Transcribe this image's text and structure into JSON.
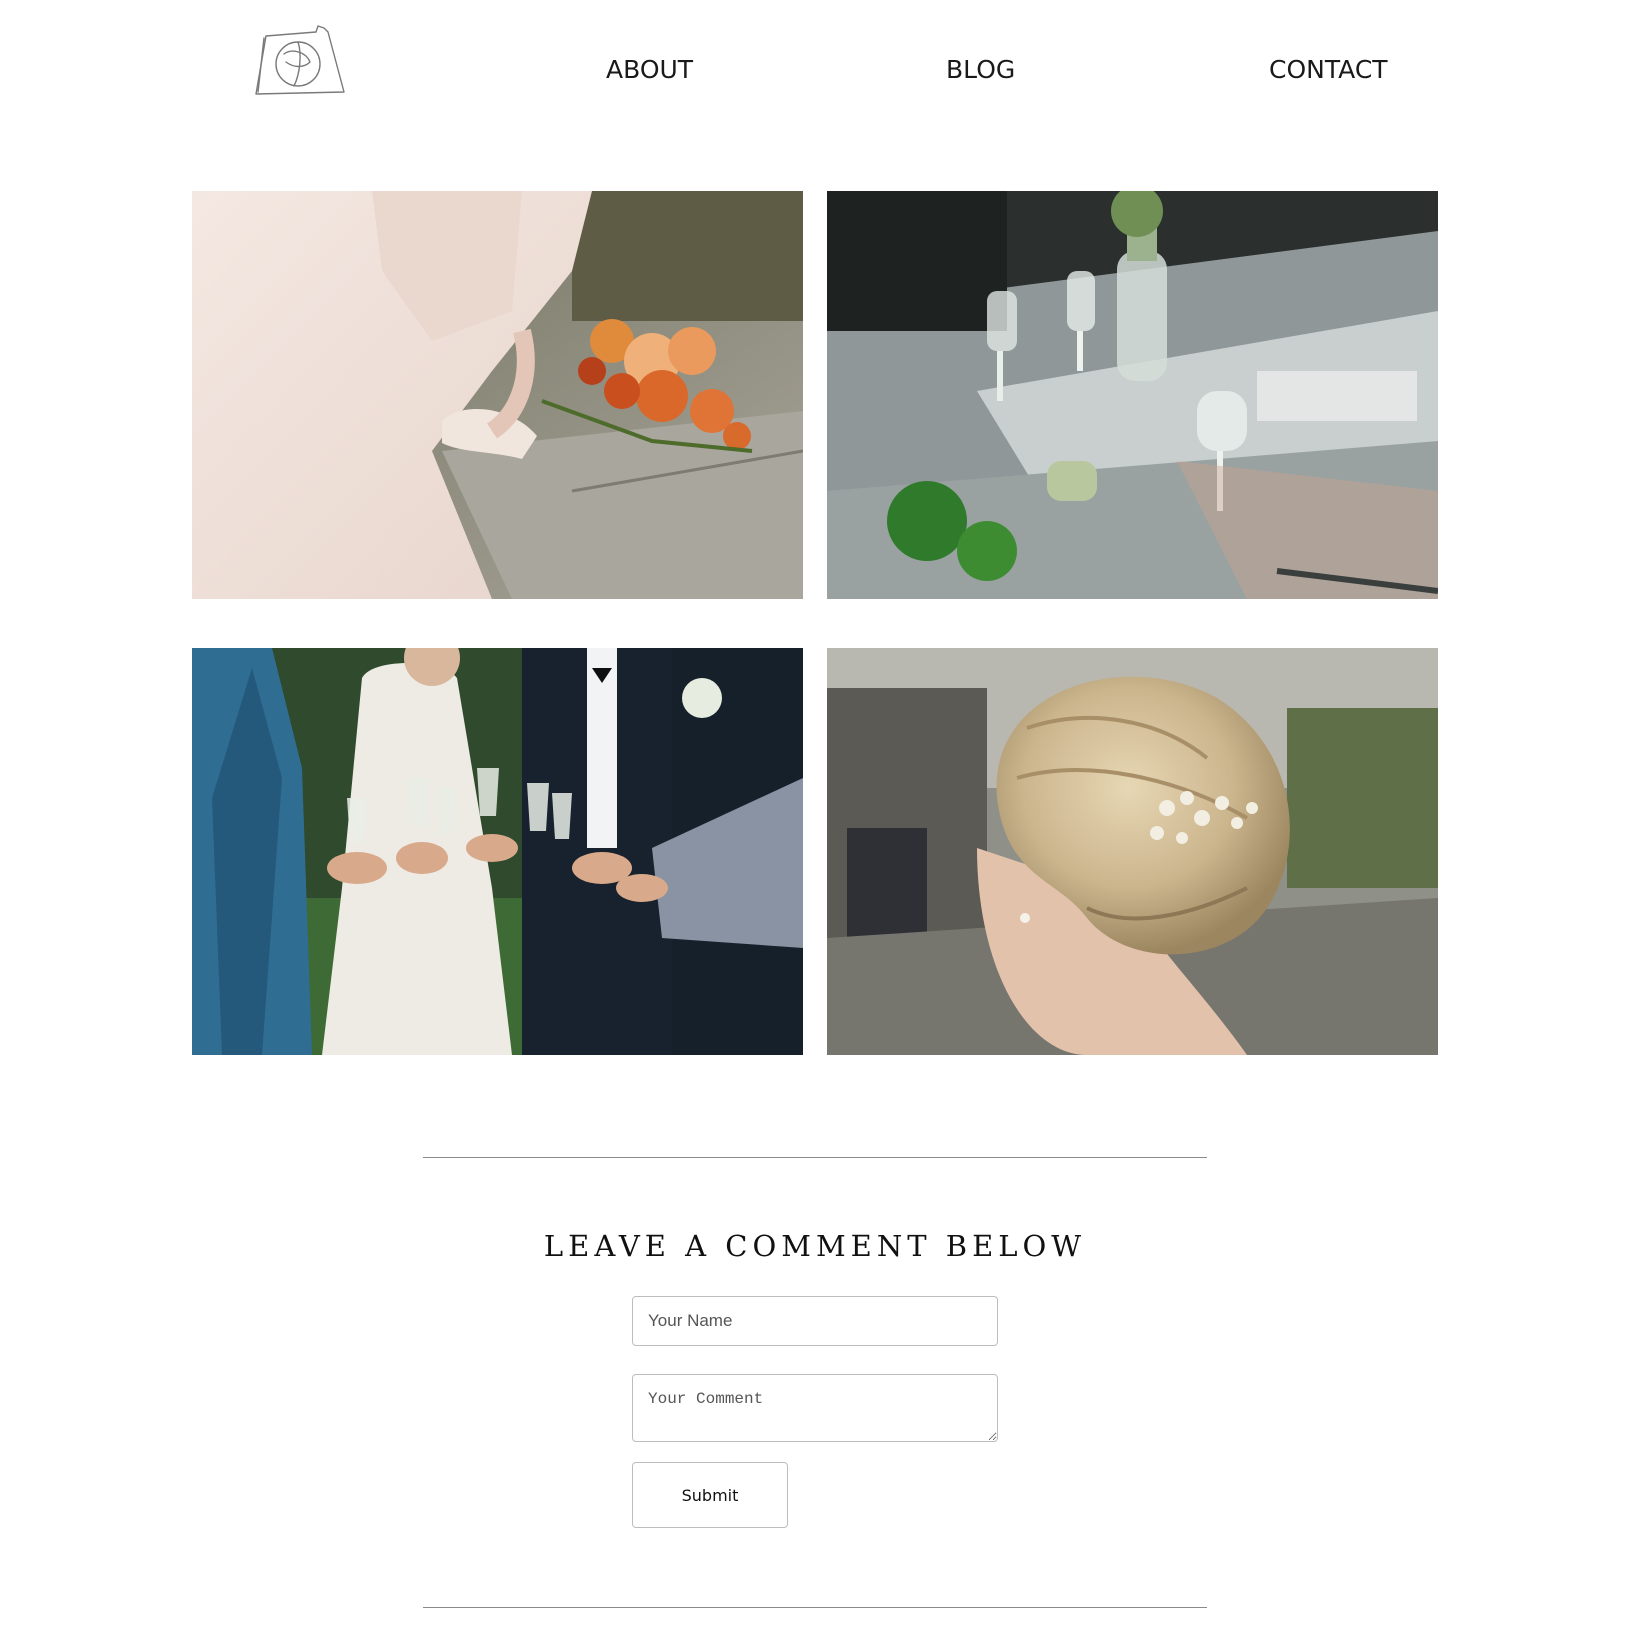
{
  "header": {
    "logo_icon": "sketch-logo-icon",
    "nav": {
      "about_label": "ABOUT",
      "blog_label": "BLOG",
      "contact_label": "CONTACT"
    }
  },
  "gallery": {
    "photos": [
      {
        "subject": "bride-shoes-and-orange-bouquet-photo"
      },
      {
        "subject": "wedding-table-glasses-photo"
      },
      {
        "subject": "wedding-party-toast-photo"
      },
      {
        "subject": "bride-updo-hairpiece-photo"
      }
    ]
  },
  "comment_form": {
    "heading": "LEAVE A COMMENT BELOW",
    "name_placeholder": "Your Name",
    "comment_placeholder": "Your Comment",
    "submit_label": "Submit"
  },
  "colors": {
    "text": "#1a1a1a",
    "divider": "#8a8a8a",
    "field_border": "#bdbdbd",
    "background": "#ffffff"
  }
}
